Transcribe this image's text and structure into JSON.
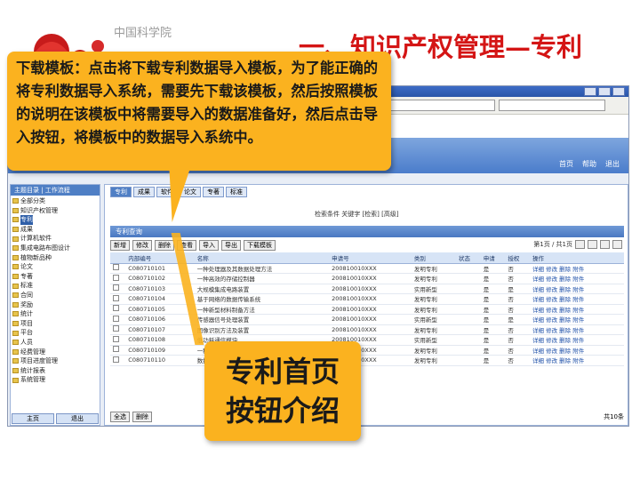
{
  "header": {
    "org": "中国科学院",
    "title": "一、知识产权管理—专利"
  },
  "callout": {
    "text": "下载模板：点击将下载专利数据导入模板，为了能正确的将专利数据导入系统，需要先下载该模板，然后按照模板的说明在该模板中将需要导入的数据准备好，然后点击导入按钮，将模板中的数据导入系统中。"
  },
  "button_callout": {
    "line1": "专利首页",
    "line2": "按钮介绍"
  },
  "app": {
    "strip_links": [
      "首页",
      "帮助",
      "退出"
    ],
    "sidebar_head": "主题目录 | 工作流程",
    "tree": [
      {
        "label": "全部分类",
        "selected": false
      },
      {
        "label": "知识产权管理",
        "selected": false
      },
      {
        "label": "专利",
        "selected": true
      },
      {
        "label": "成果",
        "selected": false
      },
      {
        "label": "计算机软件",
        "selected": false
      },
      {
        "label": "集成电路布图设计",
        "selected": false
      },
      {
        "label": "植物新品种",
        "selected": false
      },
      {
        "label": "论文",
        "selected": false
      },
      {
        "label": "专著",
        "selected": false
      },
      {
        "label": "标准",
        "selected": false
      },
      {
        "label": "合同",
        "selected": false
      },
      {
        "label": "奖励",
        "selected": false
      },
      {
        "label": "统计",
        "selected": false
      },
      {
        "label": "项目",
        "selected": false
      },
      {
        "label": "平台",
        "selected": false
      },
      {
        "label": "人员",
        "selected": false
      },
      {
        "label": "经费管理",
        "selected": false
      },
      {
        "label": "项目进度管理",
        "selected": false
      },
      {
        "label": "统计报表",
        "selected": false
      },
      {
        "label": "系统管理",
        "selected": false
      }
    ],
    "side_buttons": [
      "主页",
      "退出"
    ],
    "tabs": [
      "专利",
      "成果",
      "软件",
      "论文",
      "专著",
      "标准"
    ],
    "filters": "检索条件  关键字 [检索] [高级]",
    "subhead": "专利查询",
    "toolbar": [
      "新增",
      "修改",
      "删除",
      "查看",
      "导入",
      "导出",
      "下载模板"
    ],
    "pager_text": "第1页 / 共1页",
    "columns": [
      "",
      "内部编号",
      "名称",
      "申请号",
      "类别",
      "状态",
      "申请",
      "授权",
      "操作"
    ],
    "rows": [
      [
        "C080710101",
        "一种处理器及其数据处理方法",
        "200810010XXX",
        "发明专利",
        "是",
        "否",
        "详细 修改 删除 附件"
      ],
      [
        "C080710102",
        "一种高效的存储控制器",
        "200810010XXX",
        "发明专利",
        "是",
        "否",
        "详细 修改 删除 附件"
      ],
      [
        "C080710103",
        "大规模集成电路装置",
        "200810010XXX",
        "实用新型",
        "是",
        "是",
        "详细 修改 删除 附件"
      ],
      [
        "C080710104",
        "基于网络的数据传输系统",
        "200810010XXX",
        "发明专利",
        "是",
        "否",
        "详细 修改 删除 附件"
      ],
      [
        "C080710105",
        "一种新型材料制备方法",
        "200810010XXX",
        "发明专利",
        "是",
        "否",
        "详细 修改 删除 附件"
      ],
      [
        "C080710106",
        "传感器信号处理装置",
        "200810010XXX",
        "实用新型",
        "是",
        "是",
        "详细 修改 删除 附件"
      ],
      [
        "C080710107",
        "图像识别方法及装置",
        "200810010XXX",
        "发明专利",
        "是",
        "否",
        "详细 修改 删除 附件"
      ],
      [
        "C080710108",
        "低功耗通信模块",
        "200810010XXX",
        "实用新型",
        "是",
        "否",
        "详细 修改 删除 附件"
      ],
      [
        "C080710109",
        "一种测量仪器",
        "200810010XXX",
        "发明专利",
        "是",
        "否",
        "详细 修改 删除 附件"
      ],
      [
        "C080710110",
        "数据存储结构及方法",
        "200810010XXX",
        "发明专利",
        "是",
        "否",
        "详细 修改 删除 附件"
      ]
    ],
    "bottom_buttons": [
      "全选",
      "删除"
    ],
    "bottom_text": "共10条"
  }
}
